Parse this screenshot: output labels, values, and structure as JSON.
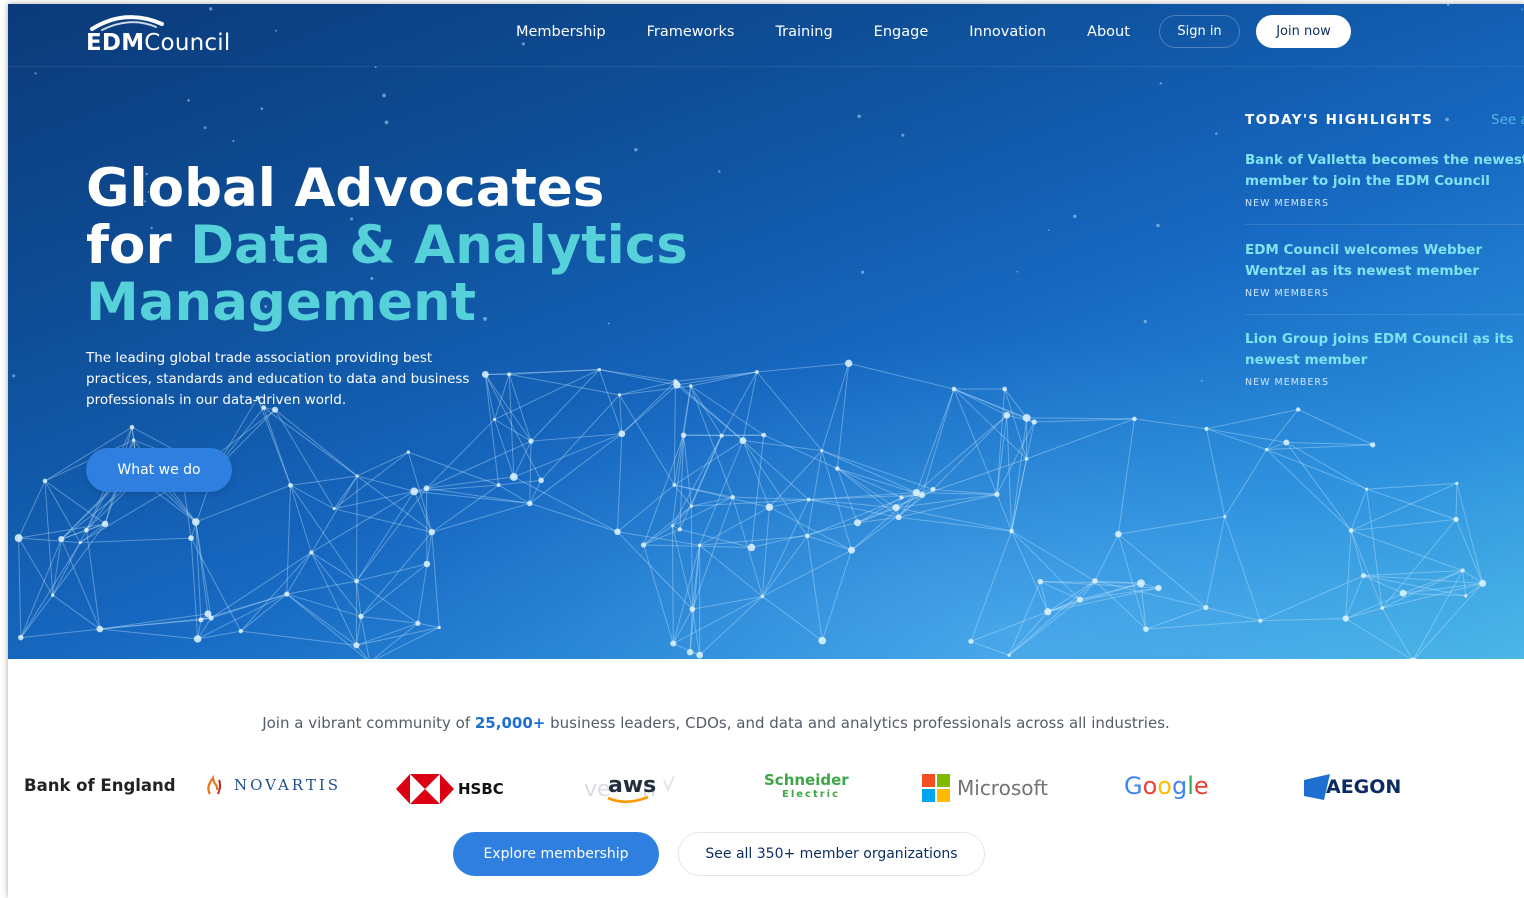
{
  "brand": {
    "name_bold": "EDM",
    "name_rest": "Council"
  },
  "nav": {
    "links": [
      "Membership",
      "Frameworks",
      "Training",
      "Engage",
      "Innovation",
      "About"
    ],
    "signin_label": "Sign in",
    "join_label": "Join now"
  },
  "hero": {
    "headline_line1": "Global Advocates",
    "headline_line2_plain": "for ",
    "headline_line2_accent": "Data & Analytics",
    "headline_line3": "Management",
    "subtitle": "The leading global trade association providing best practices, standards and education to data and business professionals in our data-driven world.",
    "cta_label": "What we do"
  },
  "highlights": {
    "heading": "TODAY'S HIGHLIGHTS",
    "see_all": "See all",
    "items": [
      {
        "title": "Bank of Valletta becomes the newest member to join the EDM Council",
        "tag": "NEW MEMBERS"
      },
      {
        "title": "EDM Council welcomes Webber Wentzel as its newest member",
        "tag": "NEW MEMBERS"
      },
      {
        "title": "Lion Group joins EDM Council as its newest member",
        "tag": "NEW MEMBERS"
      }
    ]
  },
  "community": {
    "text_before": "Join a vibrant community of ",
    "number": "25,000+",
    "text_after": " business leaders, CDOs, and data and analytics professionals across all industries."
  },
  "member_logos": {
    "boe": "Bank of England",
    "novartis": "NOVARTIS",
    "hsbc": "HSBC",
    "aws": "aws",
    "schneider_top": "Schneider",
    "schneider_bottom": "Electric",
    "microsoft": "Microsoft",
    "google": "Google",
    "aegon": "AEGON"
  },
  "actions": {
    "explore_label": "Explore membership",
    "see_all_label": "See all 350+ member organizations"
  },
  "colors": {
    "accent_teal": "#56d1d9",
    "highlight_title": "#7fe3f0",
    "primary_button": "#2f7fe0",
    "count_blue": "#1d6fd0"
  }
}
